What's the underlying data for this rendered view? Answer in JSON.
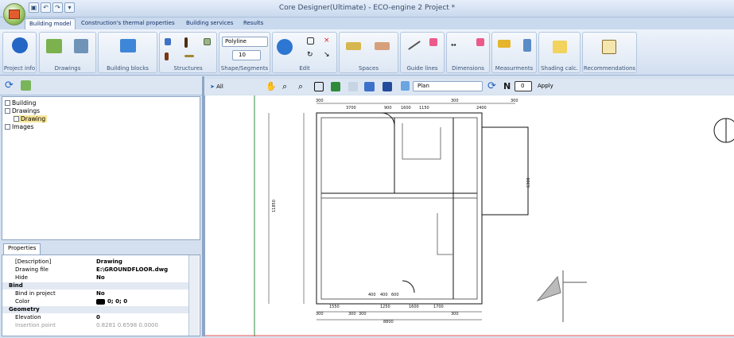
{
  "window": {
    "title": "Core Designer(Ultimate) - ECO-engine 2 Project *"
  },
  "tabs": [
    "Building model",
    "Construction's thermal properties",
    "Building services",
    "Results"
  ],
  "ribbon": {
    "groups": [
      "Project info",
      "Drawings",
      "Building blocks",
      "Structures",
      "Shape/Segments",
      "Edit",
      "Spaces",
      "Guide lines",
      "Dimensions",
      "Measurments",
      "Shading calc.",
      "Recommendations"
    ],
    "shape_select": "Polyline",
    "shape_number": "10"
  },
  "tree": {
    "building": "Building",
    "drawings": "Drawings",
    "drawing": "Drawing",
    "images": "Images"
  },
  "properties": {
    "tab": "Properties",
    "rows": [
      {
        "key": "[Description]",
        "value": "Drawing"
      },
      {
        "key": "Drawing file",
        "value": "E:\\GROUNDFLOOR.dwg"
      },
      {
        "key": "Hide",
        "value": "No"
      },
      {
        "category": "Bind"
      },
      {
        "key": "Bind in project",
        "value": "No"
      },
      {
        "key": "Color",
        "value": "0; 0; 0"
      },
      {
        "category": "Geometry"
      },
      {
        "key": "Elevation",
        "value": "0"
      },
      {
        "key": "Insertion point",
        "value": "0.8281 0.6598 0.0000"
      }
    ]
  },
  "cad_toolbar": {
    "filter": "All",
    "view": "Plan",
    "north_value": "0",
    "apply": "Apply"
  },
  "plan_dims": [
    "300",
    "3700",
    "900",
    "1600",
    "1150",
    "300",
    "2400",
    "300",
    "1550",
    "300",
    "1250",
    "1600",
    "1700",
    "8800",
    "400",
    "400",
    "600",
    "300",
    "300",
    "300",
    "11850",
    "6300"
  ]
}
